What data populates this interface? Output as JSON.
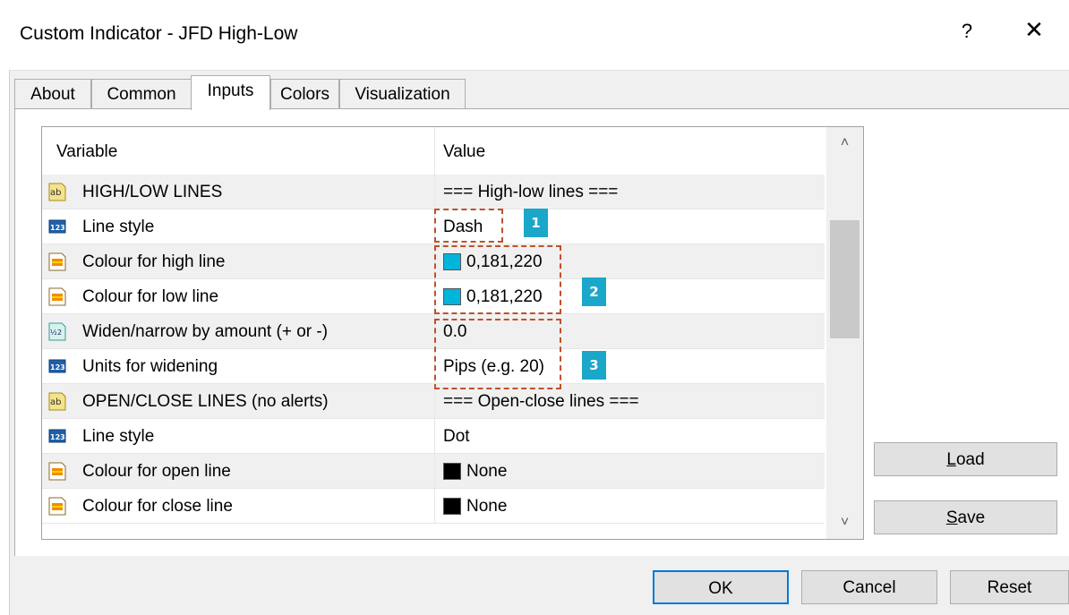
{
  "window": {
    "title": "Custom Indicator - JFD High-Low",
    "help_glyph": "?",
    "close_glyph": "✕"
  },
  "tabs": [
    {
      "label": "About"
    },
    {
      "label": "Common"
    },
    {
      "label": "Inputs",
      "active": true
    },
    {
      "label": "Colors"
    },
    {
      "label": "Visualization"
    }
  ],
  "table": {
    "headers": {
      "variable": "Variable",
      "value": "Value"
    },
    "rows": [
      {
        "icon": "string-icon",
        "name": "HIGH/LOW LINES",
        "value": "=== High-low lines ==="
      },
      {
        "icon": "integer-icon",
        "name": "Line style",
        "value": "Dash"
      },
      {
        "icon": "color-icon",
        "name": "Colour for high line",
        "value": "0,181,220",
        "swatch": "#00b5dc"
      },
      {
        "icon": "color-icon",
        "name": "Colour for low line",
        "value": "0,181,220",
        "swatch": "#00b5dc"
      },
      {
        "icon": "double-icon",
        "name": "Widen/narrow by amount (+ or -)",
        "value": "0.0"
      },
      {
        "icon": "integer-icon",
        "name": "Units for widening",
        "value": "Pips (e.g. 20)"
      },
      {
        "icon": "string-icon",
        "name": "OPEN/CLOSE LINES (no alerts)",
        "value": "=== Open-close lines ==="
      },
      {
        "icon": "integer-icon",
        "name": "Line style",
        "value": "Dot"
      },
      {
        "icon": "color-icon",
        "name": "Colour for open line",
        "value": "None",
        "swatch": "#000000"
      },
      {
        "icon": "color-icon",
        "name": "Colour for close line",
        "value": "None",
        "swatch": "#000000"
      }
    ]
  },
  "side_buttons": {
    "load": {
      "accel": "L",
      "rest": "oad"
    },
    "save": {
      "accel": "S",
      "rest": "ave"
    }
  },
  "buttons": {
    "ok": "OK",
    "cancel": "Cancel",
    "reset": "Reset"
  },
  "annotations": [
    {
      "number": "1"
    },
    {
      "number": "2"
    },
    {
      "number": "3"
    }
  ],
  "colors": {
    "accent": "#0078d7",
    "annotation_border": "#c0502a",
    "badge": "#1aa7c9",
    "swatch_cyan": "#00b5dc"
  }
}
